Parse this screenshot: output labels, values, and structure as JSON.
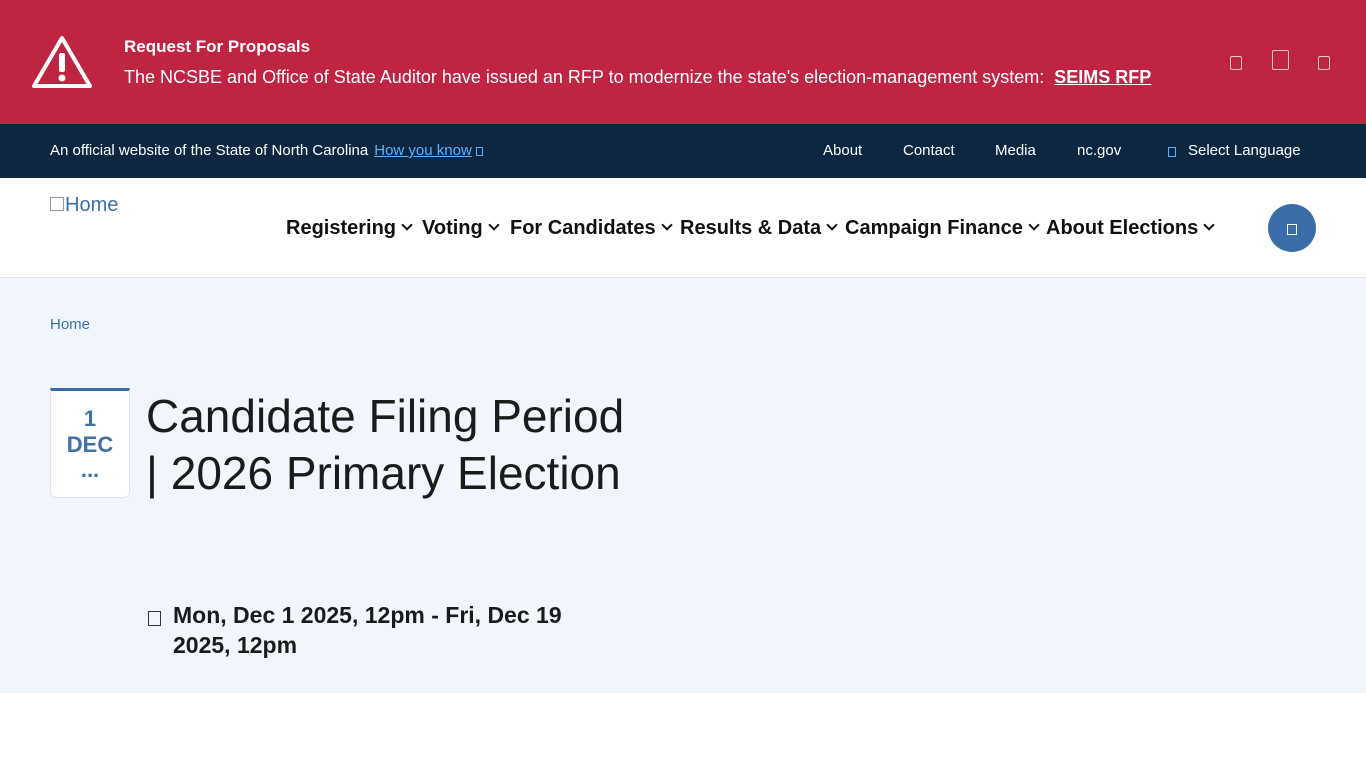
{
  "alert": {
    "title": "Request For Proposals",
    "body": "The NCSBE and Office of State Auditor have issued an RFP to modernize the state's election-management system:",
    "link_label": "SEIMS RFP",
    "controls": [
      "previous-icon",
      "pause-icon",
      "next-icon"
    ],
    "color": "#bf2443"
  },
  "official_bar": {
    "text": "An official website of the State of North Carolina",
    "how_link": "How you know",
    "links": [
      "About",
      "Contact",
      "Media",
      "nc.gov"
    ],
    "language_label": "Select Language",
    "color": "#0d2740"
  },
  "header": {
    "logo_alt": "Home",
    "nav": [
      "Registering",
      "Voting",
      "For Candidates",
      "Results & Data",
      "Campaign Finance",
      "About Elections"
    ],
    "search_icon": "search-icon",
    "accent": "#3b6ea8"
  },
  "breadcrumb": {
    "home": "Home"
  },
  "event": {
    "day": "1",
    "month": "DEC",
    "more": "...",
    "title": "Candidate Filing Period | 2026 Primary Election",
    "date_range": "Mon, Dec 1 2025, 12pm - Fri, Dec 19 2025, 12pm",
    "calendar_icon": "calendar-icon"
  }
}
